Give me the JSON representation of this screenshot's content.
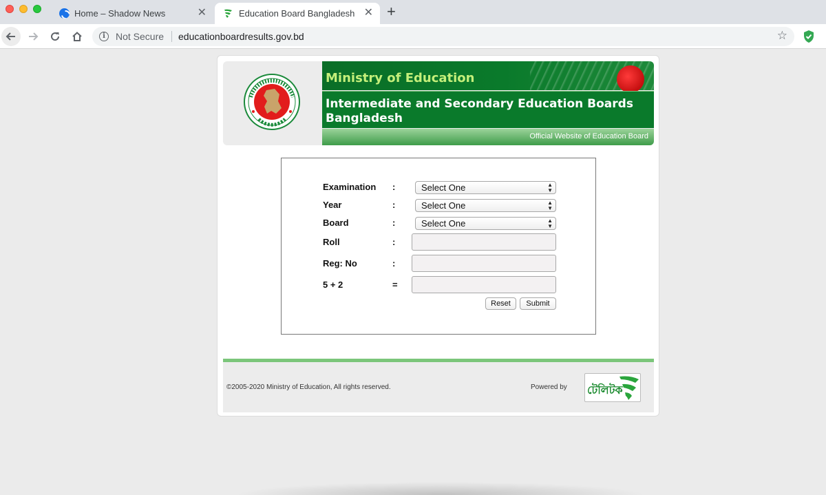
{
  "browser": {
    "tabs": [
      {
        "title": "Home – Shadow News",
        "active": false
      },
      {
        "title": "Education Board Bangladesh",
        "active": true
      }
    ],
    "new_tab_symbol": "+",
    "close_symbol": "✕",
    "security_label": "Not Secure",
    "url": "educationboardresults.gov.bd",
    "icons": {
      "back": "arrow-left-icon",
      "forward": "arrow-right-icon",
      "reload": "reload-icon",
      "home": "home-icon",
      "info": "info-icon",
      "bookmark": "star-icon",
      "extension": "shield-icon"
    }
  },
  "header": {
    "ministry": "Ministry of Education",
    "boards_title": "Intermediate and Secondary Education Boards Bangladesh",
    "official_text": "Official Website of Education Board",
    "colors": {
      "green": "#0a7a2b",
      "light_green": "#c4ef7a",
      "red": "#e21c1c"
    }
  },
  "form": {
    "rows": [
      {
        "label": "Examination",
        "sep": ":",
        "kind": "select",
        "value": "Select One"
      },
      {
        "label": "Year",
        "sep": ":",
        "kind": "select",
        "value": "Select One"
      },
      {
        "label": "Board",
        "sep": ":",
        "kind": "select",
        "value": "Select One"
      },
      {
        "label": "Roll",
        "sep": ":",
        "kind": "input",
        "value": ""
      },
      {
        "label": "Reg: No",
        "sep": ":",
        "kind": "input",
        "value": ""
      },
      {
        "label": "5 + 2",
        "sep": "=",
        "kind": "input",
        "value": ""
      }
    ],
    "reset_label": "Reset",
    "submit_label": "Submit"
  },
  "footer": {
    "copyright": "©2005-2020 Ministry of Education, All rights reserved.",
    "powered_by": "Powered by",
    "logo_text": "টেলিটক"
  }
}
